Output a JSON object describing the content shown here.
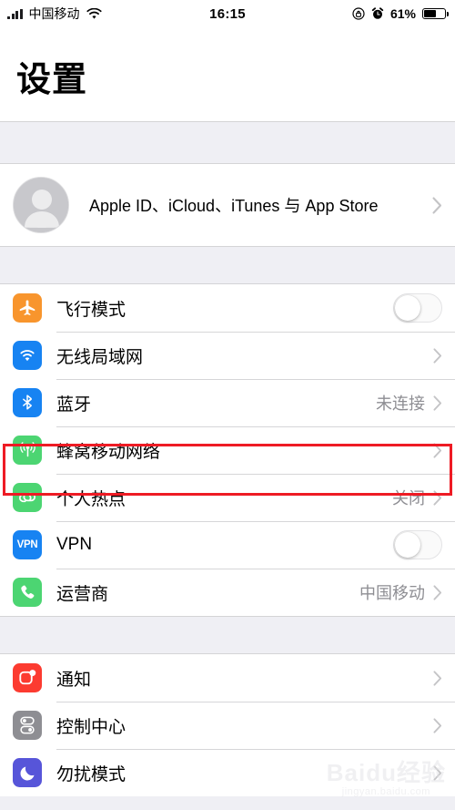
{
  "statusbar": {
    "signal_icon": "signal-bars-icon",
    "carrier": "中国移动",
    "wifi_icon": "wifi-icon",
    "time": "16:15",
    "rotation_lock_icon": "rotation-lock-icon",
    "alarm_icon": "alarm-clock-icon",
    "battery_percent": "61%",
    "battery_level": 61,
    "battery_icon": "battery-icon"
  },
  "header": {
    "title": "设置"
  },
  "account": {
    "avatar_icon": "person-avatar-icon",
    "label": "Apple ID、iCloud、iTunes 与 App Store",
    "chevron_icon": "chevron-right-icon"
  },
  "groups": [
    {
      "name": "connectivity-primary",
      "rows": [
        {
          "name": "airplane-mode",
          "icon": "airplane-icon",
          "icon_color": "#F8952D",
          "label": "飞行模式",
          "control": "toggle",
          "toggle_on": false
        },
        {
          "name": "wifi",
          "icon": "wifi-icon",
          "icon_color": "#1783F2",
          "label": "无线局域网",
          "control": "chevron",
          "value": ""
        },
        {
          "name": "bluetooth",
          "icon": "bluetooth-icon",
          "icon_color": "#1783F2",
          "label": "蓝牙",
          "control": "chevron",
          "value": "未连接"
        },
        {
          "name": "cellular",
          "icon": "cellular-antenna-icon",
          "icon_color": "#4CD572",
          "label": "蜂窝移动网络",
          "control": "chevron",
          "value": "",
          "highlighted": true
        },
        {
          "name": "personal-hotspot",
          "icon": "hotspot-link-icon",
          "icon_color": "#4CD572",
          "label": "个人热点",
          "control": "chevron",
          "value": "关闭"
        },
        {
          "name": "vpn",
          "icon": "vpn-icon",
          "icon_color": "#1783F2",
          "label": "VPN",
          "control": "toggle",
          "toggle_on": false
        },
        {
          "name": "carrier",
          "icon": "phone-icon",
          "icon_color": "#4CD572",
          "label": "运营商",
          "control": "chevron",
          "value": "中国移动"
        }
      ]
    },
    {
      "name": "system-preferences",
      "rows": [
        {
          "name": "notifications",
          "icon": "notification-badge-icon",
          "icon_color": "#FC3B30",
          "label": "通知",
          "control": "chevron",
          "value": ""
        },
        {
          "name": "control-center",
          "icon": "control-center-toggles-icon",
          "icon_color": "#8E8E93",
          "label": "控制中心",
          "control": "chevron",
          "value": ""
        },
        {
          "name": "do-not-disturb",
          "icon": "moon-icon",
          "icon_color": "#5755D9",
          "label": "勿扰模式",
          "control": "chevron",
          "value": ""
        }
      ]
    }
  ],
  "annotation": {
    "name": "cellular-highlight-box",
    "color": "#ee1b24"
  },
  "watermark": {
    "line1": "Baidu经验",
    "line2": "jingyan.baidu.com"
  }
}
